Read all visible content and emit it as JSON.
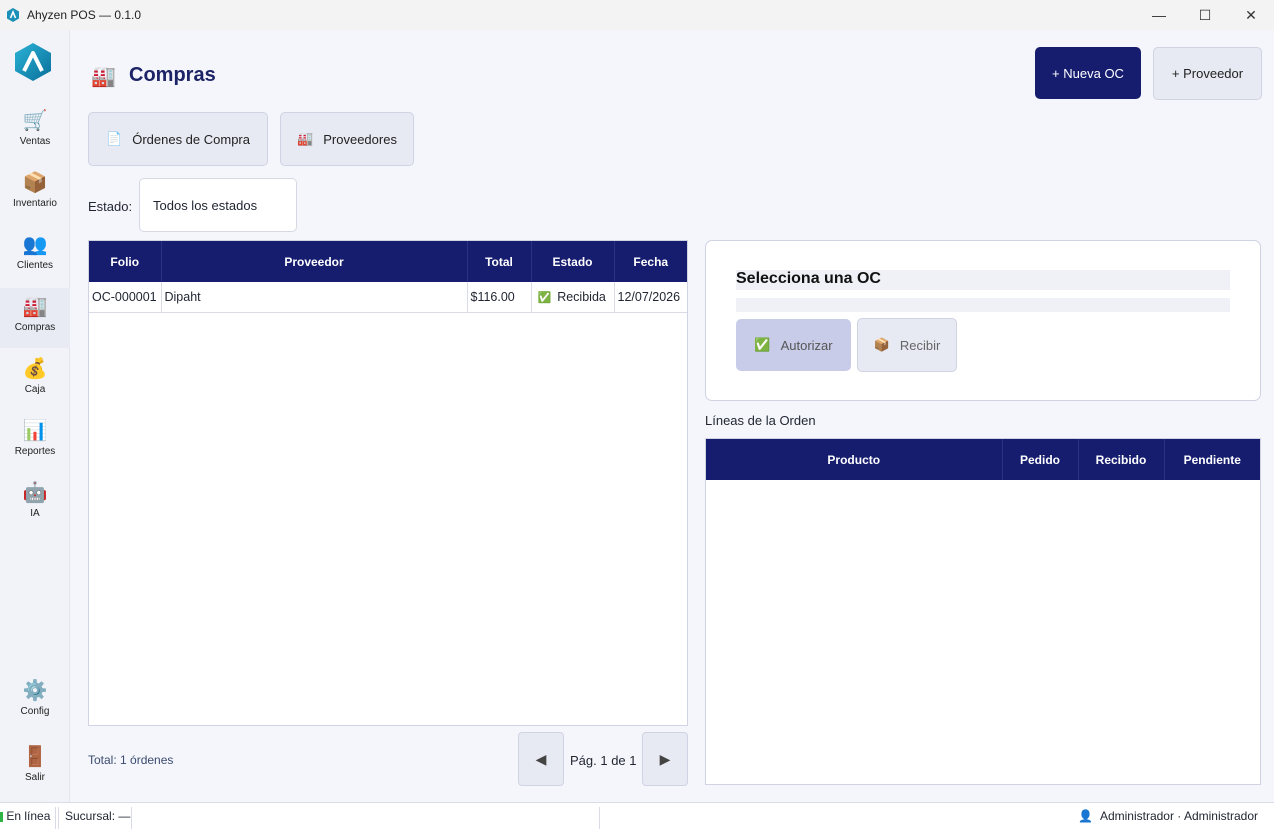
{
  "window": {
    "title": "Ahyzen POS — 0.1.0"
  },
  "sidebar": {
    "items": [
      {
        "label": "Ventas",
        "icon": "cart-icon",
        "glyph": "🛒"
      },
      {
        "label": "Inventario",
        "icon": "box-icon",
        "glyph": "📦"
      },
      {
        "label": "Clientes",
        "icon": "people-icon",
        "glyph": "👥"
      },
      {
        "label": "Compras",
        "icon": "factory-icon",
        "glyph": "🏭"
      },
      {
        "label": "Caja",
        "icon": "money-bag-icon",
        "glyph": "💰"
      },
      {
        "label": "Reportes",
        "icon": "chart-icon",
        "glyph": "📊"
      },
      {
        "label": "IA",
        "icon": "robot-icon",
        "glyph": "🤖"
      }
    ],
    "config": {
      "label": "Config",
      "icon": "gear-icon",
      "glyph": "⚙️"
    },
    "exit": {
      "label": "Salir",
      "icon": "door-icon",
      "glyph": "🚪"
    }
  },
  "header": {
    "title": "Compras",
    "title_icon": "🏭",
    "new_po": "+ Nueva OC",
    "new_supplier": "+ Proveedor"
  },
  "tabs": [
    {
      "label": "Órdenes de Compra",
      "glyph": "📄"
    },
    {
      "label": "Proveedores",
      "glyph": "🏭"
    }
  ],
  "filter": {
    "label": "Estado:",
    "value": "Todos los estados"
  },
  "orders_table": {
    "columns": [
      "Folio",
      "Proveedor",
      "Total",
      "Estado",
      "Fecha"
    ],
    "rows": [
      {
        "folio": "OC-000001",
        "proveedor": "Dipaht",
        "total": "$116.00",
        "estado": "Recibida",
        "estado_glyph": "✅",
        "fecha": "12/07/2026"
      }
    ]
  },
  "footer": {
    "total": "Total: 1 órdenes",
    "page": "Pág. 1 de 1",
    "prev": "◀",
    "next": "▶"
  },
  "detail": {
    "title": "Selecciona una OC",
    "authorize": "Autorizar",
    "authorize_glyph": "✅",
    "receive": "Recibir",
    "receive_glyph": "📦"
  },
  "lines": {
    "label": "Líneas de la Orden",
    "columns": [
      "Producto",
      "Pedido",
      "Recibido",
      "Pendiente"
    ]
  },
  "statusbar": {
    "online": "En línea",
    "branch": "Sucursal: —",
    "user": "Administrador · Administrador"
  },
  "colors": {
    "primary": "#161d6f",
    "online": "#2fb344"
  }
}
